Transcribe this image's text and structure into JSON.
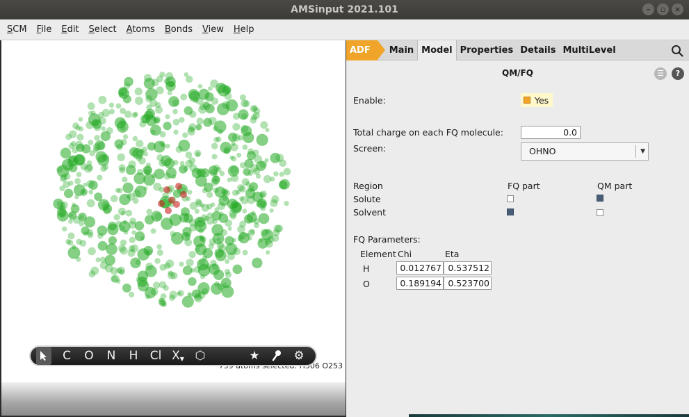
{
  "window": {
    "title": "AMSinput 2021.101"
  },
  "menu": [
    {
      "u": "S",
      "rest": "CM"
    },
    {
      "u": "F",
      "rest": "ile"
    },
    {
      "u": "E",
      "rest": "dit"
    },
    {
      "u": "S",
      "rest": "elect"
    },
    {
      "u": "A",
      "rest": "toms"
    },
    {
      "u": "B",
      "rest": "onds"
    },
    {
      "u": "V",
      "rest": "iew"
    },
    {
      "u": "H",
      "rest": "elp"
    }
  ],
  "viewport": {
    "status": "759 atoms selected: H506 O253",
    "toolbar": [
      "C",
      "O",
      "N",
      "H",
      "Cl",
      "X",
      "⬡",
      "★",
      "⚲",
      "⚙"
    ]
  },
  "tabs": {
    "engine": "ADF",
    "items": [
      "Main",
      "Model",
      "Properties",
      "Details",
      "MultiLevel"
    ],
    "active": "Model"
  },
  "qmfq": {
    "title": "QM/FQ",
    "enable_label": "Enable:",
    "enable_value": "Yes",
    "charge_label": "Total charge on each FQ molecule:",
    "charge_value": "0.0",
    "screen_label": "Screen:",
    "screen_value": "OHNO",
    "region": {
      "header": "Region",
      "fq_header": "FQ part",
      "qm_header": "QM part",
      "rows": [
        {
          "name": "Solute",
          "fq": false,
          "qm": true
        },
        {
          "name": "Solvent",
          "fq": true,
          "qm": false
        }
      ]
    },
    "params": {
      "label": "FQ Parameters:",
      "headers": [
        "Element",
        "Chi",
        "Eta"
      ],
      "rows": [
        {
          "element": "H",
          "chi": "0.012767",
          "eta": "0.537512"
        },
        {
          "element": "O",
          "chi": "0.189194",
          "eta": "0.523700"
        }
      ]
    }
  },
  "colors": {
    "accent": "#f0a52a",
    "atom_green": "#22aa22",
    "atom_red": "#cc2222",
    "checked": "#4a5d78"
  }
}
